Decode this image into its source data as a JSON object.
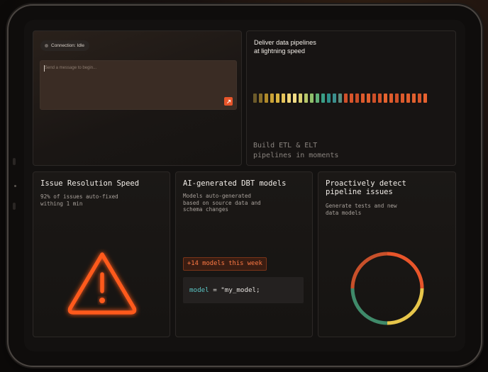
{
  "chat": {
    "status": "Connection: Idle",
    "placeholder": "Send a message to begin...",
    "send_icon": "send-arrow-icon"
  },
  "pipelines": {
    "title": "Deliver data pipelines\nat lightning speed",
    "caption": "Build ETL & ELT\npipelines in moments",
    "bar_colors": [
      "#6b5a2a",
      "#8a6f2a",
      "#b08a2a",
      "#caa236",
      "#d9b441",
      "#e6c45b",
      "#f0d57a",
      "#f2dc86",
      "#d9cf6f",
      "#b7c76a",
      "#8fbf6b",
      "#62b179",
      "#3a9e86",
      "#2f8f8a",
      "#3b8f8d",
      "#5b8e7f",
      "#d1502a",
      "#d8552b",
      "#c94e28",
      "#de5a2c",
      "#e0602f",
      "#cd4f28",
      "#d4542a",
      "#e5632f",
      "#de5c2d",
      "#cf5129",
      "#dc5a2c",
      "#e05e2e",
      "#e1612f",
      "#d5562b",
      "#e66230"
    ]
  },
  "issue": {
    "title": "Issue Resolution Speed",
    "subtitle": "92% of issues auto-fixed\nwithing 1 min",
    "icon": "warning-icon"
  },
  "dbt": {
    "title": "AI-generated DBT models",
    "subtitle": "Models auto-generated\nbased on source data and\nschema changes",
    "badge": "+14 models this week",
    "code_kw": "model",
    "code_rest": " = \"my_model;"
  },
  "detect": {
    "title": "Proactively detect\npipeline issues",
    "subtitle": "Generate tests and new\ndata models",
    "ring_colors": {
      "top": "#e8552a",
      "right": "#e6c54a",
      "left": "#3f8a6a"
    }
  }
}
